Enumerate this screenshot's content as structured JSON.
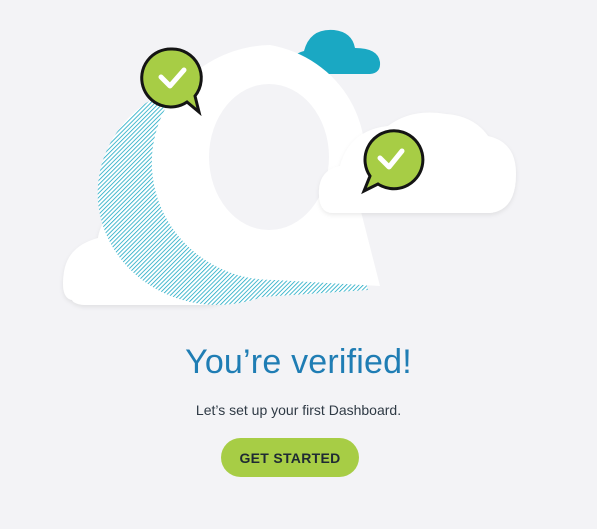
{
  "heading": "You’re verified!",
  "subheading": "Let’s set up your first Dashboard.",
  "cta_label": "GET STARTED",
  "colors": {
    "background": "#f3f3f6",
    "heading": "#1f7db4",
    "cloud": "#ffffff",
    "accent_cloud": "#1aa8c3",
    "check_bubble": "#a7cd45",
    "button": "#a7cd45"
  },
  "icons": [
    "check-bubble-icon",
    "chat-bubble-q-icon",
    "cloud-icon"
  ]
}
